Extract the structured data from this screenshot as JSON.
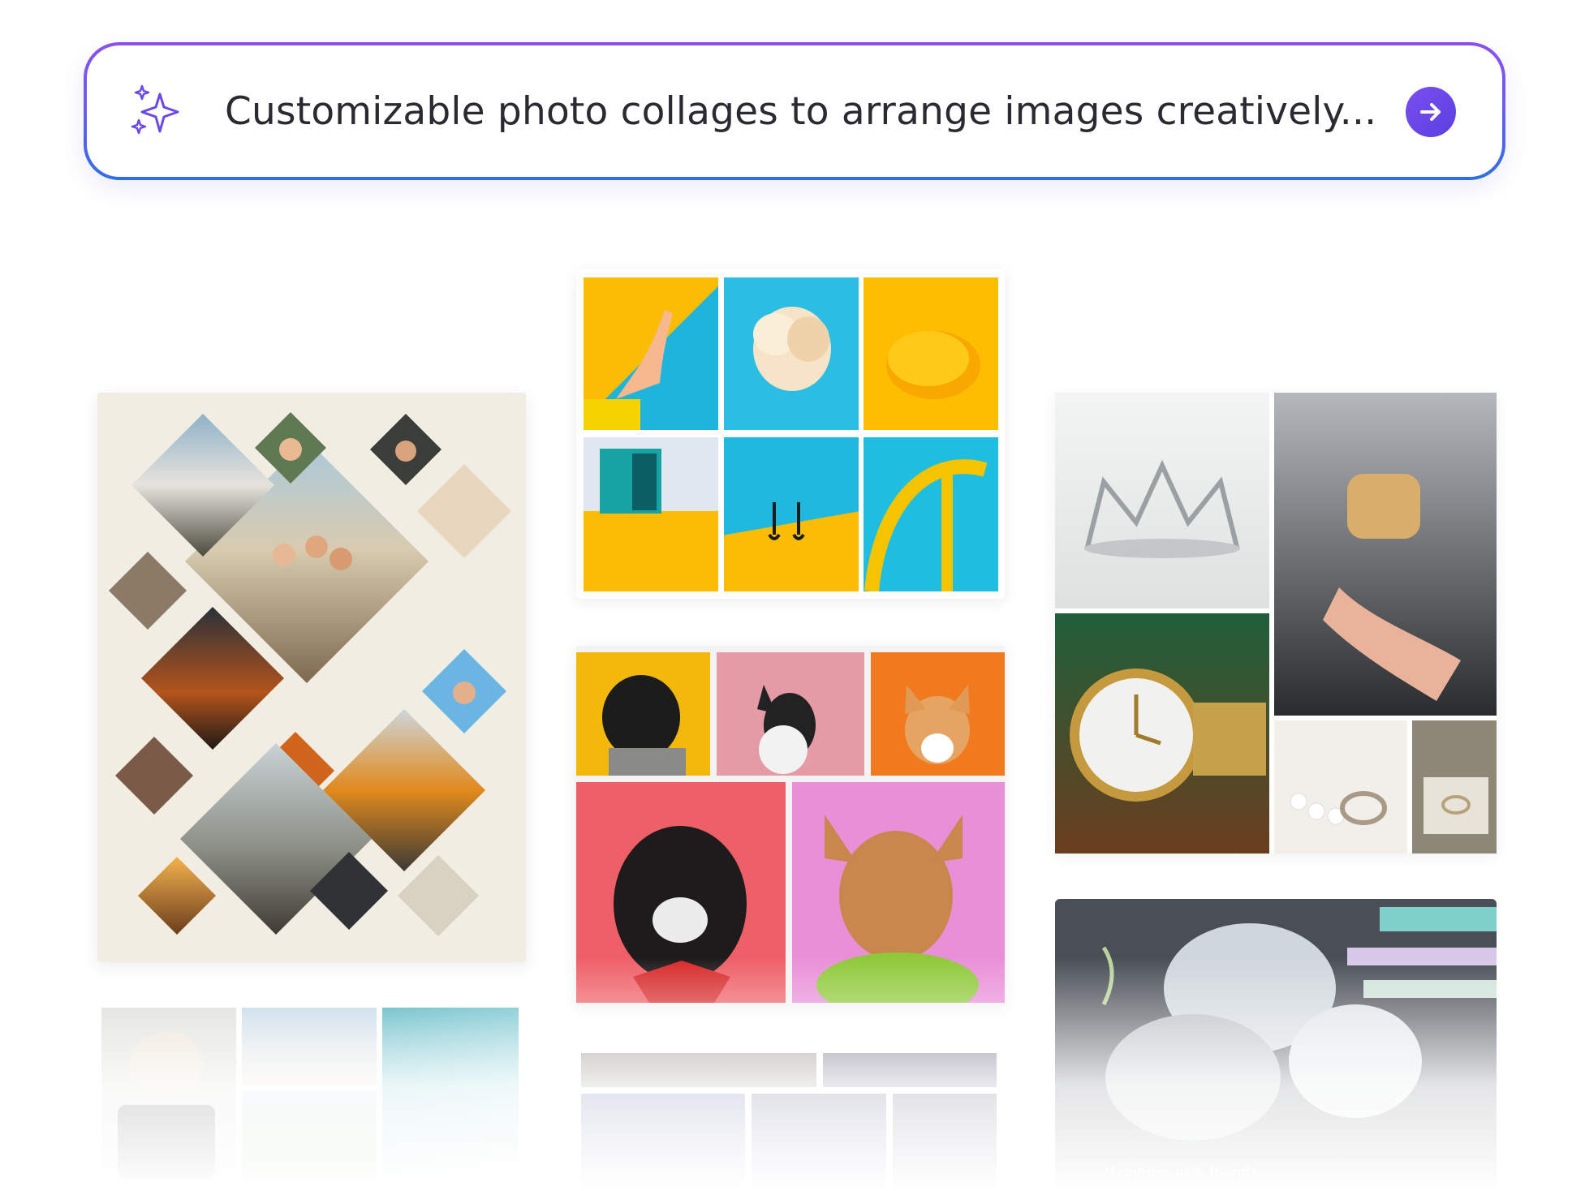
{
  "prompt": {
    "text": "Customizable photo collages to arrange images creatively...",
    "sparkle_icon": "sparkle-icon",
    "submit_icon": "arrow-right-icon",
    "accent": "#6d4ff0"
  },
  "cards": {
    "travel_diamonds": {
      "background": "#f1ede3"
    },
    "colorful_grid": {
      "yellow": "#fbbc05",
      "cyan": "#21bde0"
    },
    "dogs_grid": {
      "background": "#f4f2f3"
    },
    "jewelry_grid": {
      "background": "#ffffff"
    },
    "memories": {
      "caption": "Memories with friends",
      "background": "#4a4f57"
    }
  }
}
